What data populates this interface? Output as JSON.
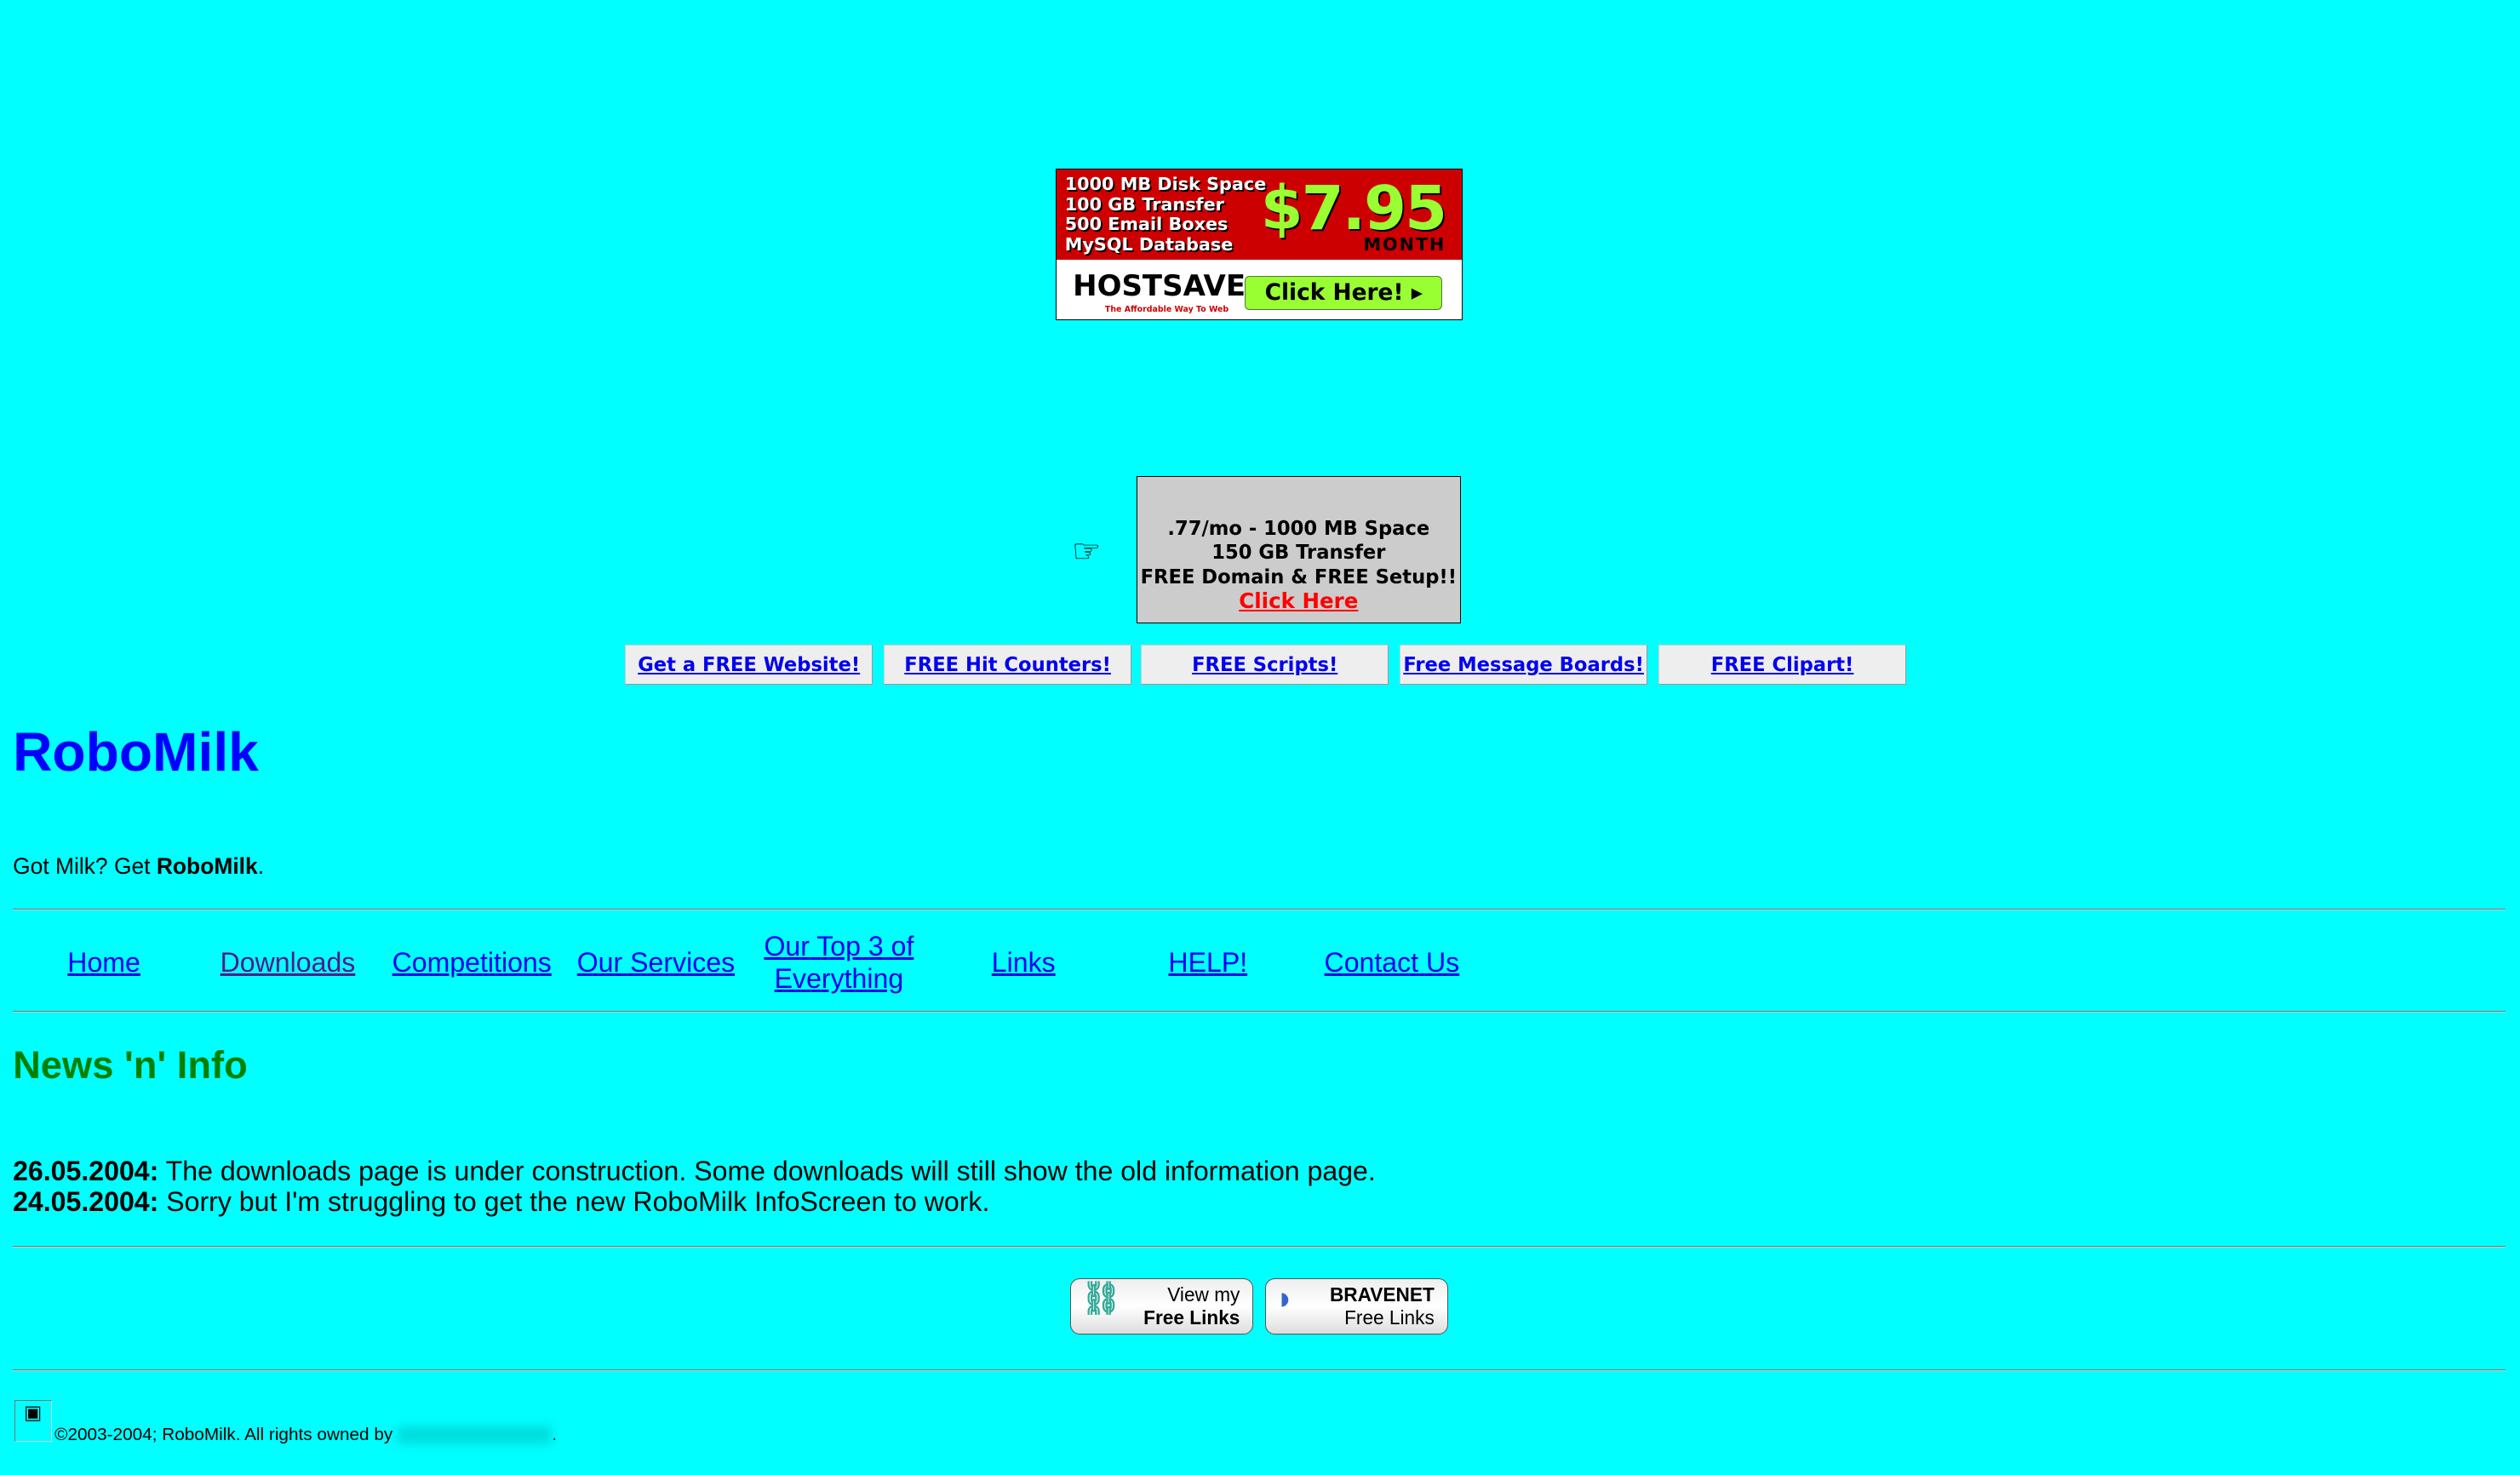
{
  "ad_banner": {
    "features": [
      "1000 MB Disk Space",
      "100 GB Transfer",
      "500 Email Boxes",
      "MySQL Database"
    ],
    "price": "$7.95",
    "period": "MONTH",
    "brand": "HOSTSAVE",
    "tagline": "The Affordable Way To Web",
    "cta": "Click Here!"
  },
  "ad_box": {
    "line1": ".77/mo - 1000 MB Space",
    "line2": "150 GB Transfer",
    "line3": "FREE Domain & FREE Setup!!",
    "link": "Click Here"
  },
  "free_links": [
    "Get a FREE Website!",
    "FREE Hit Counters!",
    "FREE Scripts!",
    "Free Message Boards!",
    "FREE Clipart!"
  ],
  "site": {
    "title": "RoboMilk",
    "tagline_prefix": "Got Milk? Get ",
    "tagline_bold": "RoboMilk",
    "tagline_suffix": "."
  },
  "nav": [
    "Home",
    "Downloads",
    "Competitions",
    "Our Services",
    "Our Top 3 of Everything",
    "Links",
    "HELP!",
    "Contact Us"
  ],
  "news": {
    "heading": "News 'n' Info",
    "items": [
      {
        "date": "26.05.2004:",
        "text": " The downloads page is under construction. Some downloads will still show the old information page."
      },
      {
        "date": "24.05.2004:",
        "text": " Sorry but I'm struggling to get the new RoboMilk InfoScreen to work."
      }
    ]
  },
  "badges": [
    {
      "line1": "View my",
      "line2": "Free Links"
    },
    {
      "line1": "BRAVENET",
      "line2": "Free Links"
    }
  ],
  "footer": {
    "text": "©2003-2004; RoboMilk. All rights owned by ",
    "end": "."
  }
}
